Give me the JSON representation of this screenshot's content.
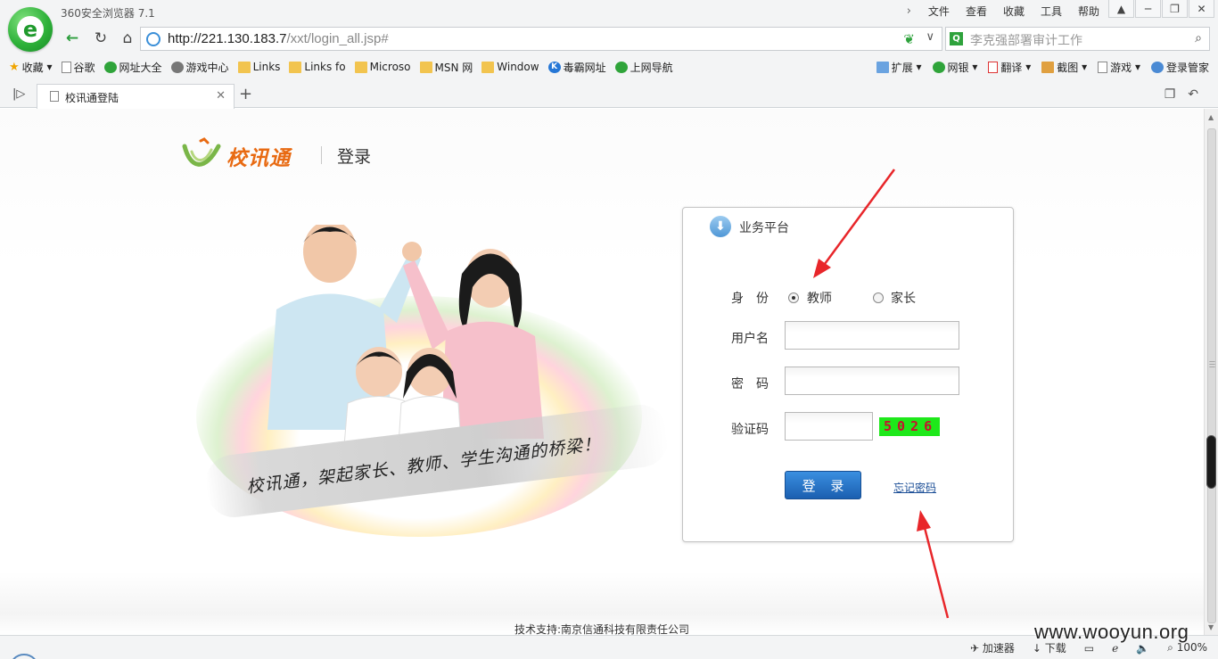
{
  "browser": {
    "title": "360安全浏览器 7.1",
    "menu": [
      "文件",
      "查看",
      "收藏",
      "工具",
      "帮助"
    ],
    "url_host": "http://221.130.183.7",
    "url_path": "/xxt/login_all.jsp#",
    "search_placeholder": "李克强部署审计工作",
    "bookmarks": [
      "收藏",
      "谷歌",
      "网址大全",
      "游戏中心",
      "Links",
      "Links fo",
      "Microso",
      "MSN 网",
      "Window",
      "毒霸网址",
      "上网导航"
    ],
    "toolbar_right": [
      "扩展",
      "网银",
      "翻译",
      "截图",
      "游戏",
      "登录管家"
    ],
    "tab_title": "校讯通登陆",
    "status_items": [
      "加速器",
      "下载",
      "100%"
    ]
  },
  "page": {
    "brand_name": "校讯通",
    "heading": "登录",
    "slogan": "校讯通，架起家长、教师、学生沟通的桥梁！",
    "panel_title": "业务平台",
    "label_role": "身　份",
    "role_teacher": "教师",
    "role_parent": "家长",
    "label_username": "用户名",
    "label_password": "密　码",
    "label_captcha": "验证码",
    "captcha_code": "5026",
    "login_button": "登 录",
    "forgot_password": "忘记密码",
    "footer": "技术支持:南京信通科技有限责任公司",
    "selected_role": "教师",
    "username_value": "",
    "password_value": "",
    "captcha_value": ""
  },
  "watermark": "www.wooyun.org",
  "colors": {
    "brand_orange": "#e86a12",
    "button_blue": "#1b5fb0",
    "captcha_bg": "#1ee81a",
    "captcha_text": "#c8102e",
    "annotation_red": "#e8262a"
  }
}
